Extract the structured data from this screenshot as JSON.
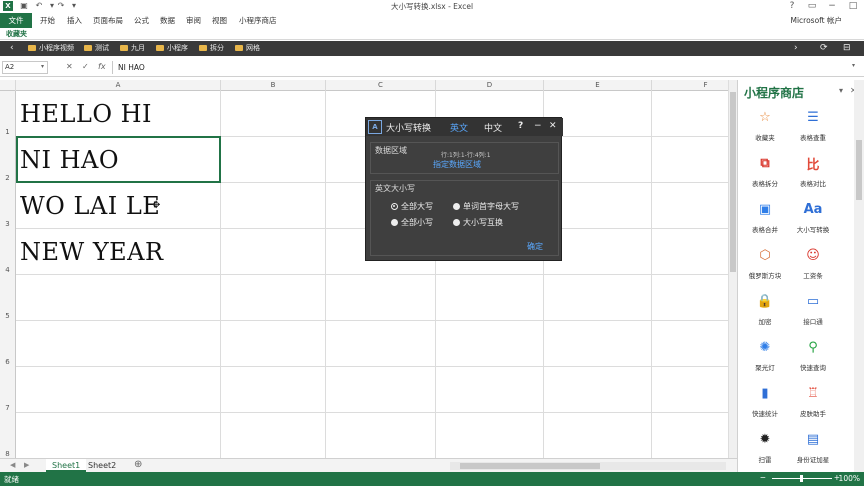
{
  "window": {
    "title": "大小写转换.xlsx - Excel",
    "account": "Microsoft 帐户"
  },
  "ribbon": {
    "file": "文件",
    "tabs": [
      "开始",
      "插入",
      "页面布局",
      "公式",
      "数据",
      "审阅",
      "视图",
      "小程序商店"
    ]
  },
  "favorites": {
    "label": "收藏夹",
    "items": [
      "小程序视频",
      "测试",
      "九月",
      "小程序",
      "拆分",
      "网格"
    ]
  },
  "formula_bar": {
    "name_box": "A2",
    "fx": "fx",
    "value": "NI HAO"
  },
  "grid": {
    "columns": [
      "A",
      "B",
      "C",
      "D",
      "E",
      "F"
    ],
    "rows": [
      "1",
      "2",
      "3",
      "4",
      "5",
      "6",
      "7",
      "8"
    ],
    "cells": [
      "HELLO HI",
      "NI HAO",
      "WO LAI LE",
      "NEW YEAR"
    ],
    "selected": "A2"
  },
  "sheets": [
    "Sheet1",
    "Sheet2"
  ],
  "status": {
    "left": "就绪",
    "zoom": "100%"
  },
  "pane": {
    "title": "小程序商店",
    "tools": [
      {
        "label": "收藏夹",
        "icon": "star-icon",
        "color": "#e8893a"
      },
      {
        "label": "表格查重",
        "icon": "list-icon",
        "color": "#2f6fd6"
      },
      {
        "label": "表格拆分",
        "icon": "split-icon",
        "color": "#d9352b"
      },
      {
        "label": "表格对比",
        "icon": "compare-icon",
        "color": "#e24a3a"
      },
      {
        "label": "表格合并",
        "icon": "merge-icon",
        "color": "#2f7ee8"
      },
      {
        "label": "大小写转换",
        "icon": "case-icon",
        "color": "#2f6fd6"
      },
      {
        "label": "俄罗斯方块",
        "icon": "cube-icon",
        "color": "#d8703a"
      },
      {
        "label": "工资条",
        "icon": "person-icon",
        "color": "#d9352b"
      },
      {
        "label": "加密",
        "icon": "lock-icon",
        "color": "#27a444"
      },
      {
        "label": "接口通",
        "icon": "monitor-icon",
        "color": "#2f6fd6"
      },
      {
        "label": "聚光灯",
        "icon": "bulb-icon",
        "color": "#2f7ee8"
      },
      {
        "label": "快速查询",
        "icon": "magnifier-icon",
        "color": "#27a444"
      },
      {
        "label": "快速统计",
        "icon": "barchart-icon",
        "color": "#2f6fd6"
      },
      {
        "label": "皮肤助手",
        "icon": "shirt-icon",
        "color": "#e24a3a"
      },
      {
        "label": "扫雷",
        "icon": "mine-icon",
        "color": "#222222"
      },
      {
        "label": "身份证加星",
        "icon": "idcard-icon",
        "color": "#2f6fd6"
      }
    ]
  },
  "dialog": {
    "logo": "A",
    "title": "大小写转换",
    "tab_english": "英文",
    "tab_chinese": "中文",
    "help": "?",
    "minimize": "−",
    "close": "✕",
    "data_area_label": "数据区域",
    "range_text": "行:1列:1-行:4列:1",
    "specify_area": "指定数据区域",
    "case_label": "英文大小写",
    "opt_all_upper": "全部大写",
    "opt_title_case": "单词首字母大写",
    "opt_all_lower": "全部小写",
    "opt_swap": "大小写互换",
    "confirm": "确定"
  }
}
